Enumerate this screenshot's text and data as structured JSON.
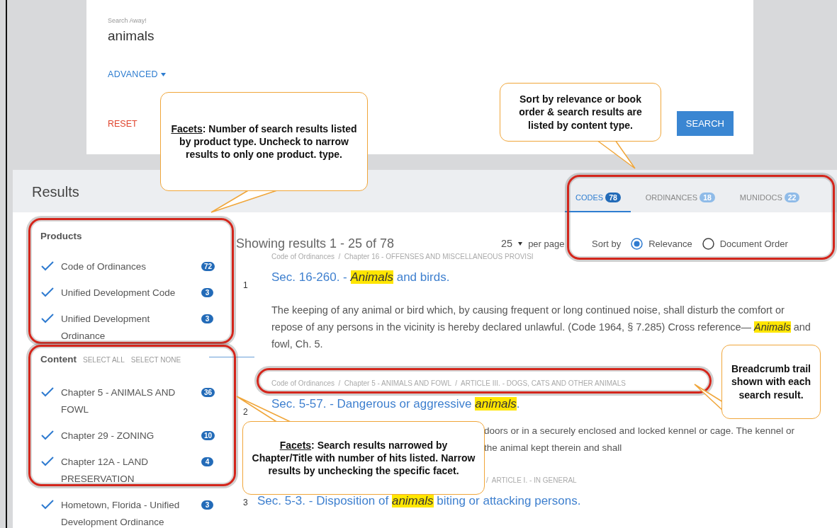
{
  "search": {
    "label": "Search Away!",
    "value": "animals",
    "advanced": "ADVANCED",
    "reset": "RESET",
    "button": "SEARCH"
  },
  "results_panel": {
    "title": "Results",
    "tabs": [
      {
        "label": "CODES",
        "count": "78",
        "selected": true
      },
      {
        "label": "ORDINANCES",
        "count": "18",
        "selected": false
      },
      {
        "label": "MUNIDOCS",
        "count": "22",
        "selected": false
      }
    ]
  },
  "products": {
    "title": "Products",
    "items": [
      {
        "label": "Code of Ordinances",
        "count": "72",
        "checked": true
      },
      {
        "label": "Unified Development Code",
        "count": "3",
        "checked": true
      },
      {
        "label": "Unified Development Ordinance",
        "count": "3",
        "checked": true
      }
    ]
  },
  "content": {
    "title": "Content",
    "select_all": "SELECT ALL",
    "select_none": "SELECT NONE",
    "items": [
      {
        "label": "Chapter 5 - ANIMALS AND FOWL",
        "count": "36",
        "checked": true
      },
      {
        "label": "Chapter 29 - ZONING",
        "count": "10",
        "checked": true
      },
      {
        "label": "Chapter 12A - LAND PRESERVATION",
        "count": "4",
        "checked": true
      },
      {
        "label": "Hometown, Florida - Unified Development Ordinance",
        "count": "3",
        "checked": true
      }
    ]
  },
  "summary": "Showing results 1 - 25 of 78",
  "per_page": {
    "value": "25",
    "label": "per page"
  },
  "sort": {
    "label": "Sort by",
    "options": [
      {
        "label": "Relevance",
        "selected": true
      },
      {
        "label": "Document Order",
        "selected": false
      }
    ]
  },
  "results": [
    {
      "kind": "full",
      "number": "1",
      "breadcrumb": "Code of Ordinances  /  Chapter 16 - OFFENSES AND MISCELLANEOUS PROVISI",
      "title": "Sec. 16-260. - *Animals* and birds.",
      "snippet": [
        "The keeping of any animal or bird which, by causing frequent or long continued noise, shall disturb the comfort or repose of any persons in the vicinity is hereby declared unlawful. (Code 1964, § 7.285) Cross reference— *Animals* and fowl, Ch. 5."
      ]
    },
    {
      "kind": "covered",
      "number": "2",
      "breadcrumb": "Code of Ordinances  /  Chapter 5 - ANIMALS AND FOWL  /  ARTICLE III. - DOGS, CATS AND OTHER ANIMALS",
      "title": "Sec. 5-57. - Dangerous or aggressive *animals*.",
      "snippet": [
        "doors or in a securely enclosed and locked kennel or cage. The kennel or",
        "the animal kept therein and shall"
      ]
    },
    {
      "kind": "covered",
      "number": "3",
      "breadcrumb": "/  ARTICLE I. - IN GENERAL",
      "title": "Sec. 5-3. - Disposition of *animals* biting or attacking persons."
    }
  ],
  "callouts": [
    {
      "text": "*Facets*:  Number of search results listed by product type.  Uncheck to narrow results to only one product. type."
    },
    {
      "text": "Sort by relevance or book order & search results are listed by content type."
    },
    {
      "text": "Breadcrumb trail shown with each search result."
    },
    {
      "text": "*Facets*:  Search results narrowed by Chapter/Title with number of hits listed. Narrow results by unchecking the specific facet."
    }
  ]
}
